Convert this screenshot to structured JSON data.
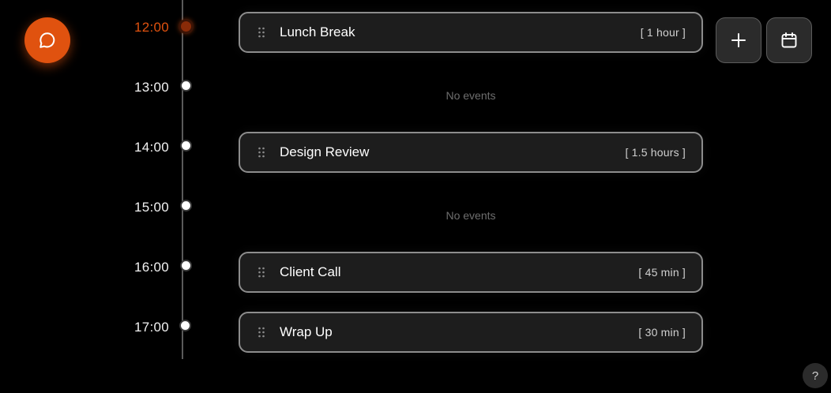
{
  "colors": {
    "accent": "#e0520f",
    "background": "#000000",
    "card_background": "#1d1d1d",
    "card_border": "#8d8d8d",
    "muted_text": "#6e6e6e"
  },
  "chat_button": {
    "icon": "chat-bubble-icon"
  },
  "toolbar": {
    "add_icon": "plus-icon",
    "calendar_icon": "calendar-icon"
  },
  "timeline": {
    "current_hour": "12:00",
    "hours": [
      {
        "label": "12:00",
        "current": true
      },
      {
        "label": "13:00",
        "current": false
      },
      {
        "label": "14:00",
        "current": false
      },
      {
        "label": "15:00",
        "current": false
      },
      {
        "label": "16:00",
        "current": false
      },
      {
        "label": "17:00",
        "current": false
      }
    ]
  },
  "events": [
    {
      "title": "Lunch Break",
      "duration": "[ 1 hour ]"
    },
    {
      "title": "Design Review",
      "duration": "[ 1.5 hours ]"
    },
    {
      "title": "Client Call",
      "duration": "[ 45 min ]"
    },
    {
      "title": "Wrap Up",
      "duration": "[ 30 min ]"
    }
  ],
  "empty_slots": [
    {
      "text": "No events"
    },
    {
      "text": "No events"
    }
  ],
  "help": {
    "label": "?"
  }
}
